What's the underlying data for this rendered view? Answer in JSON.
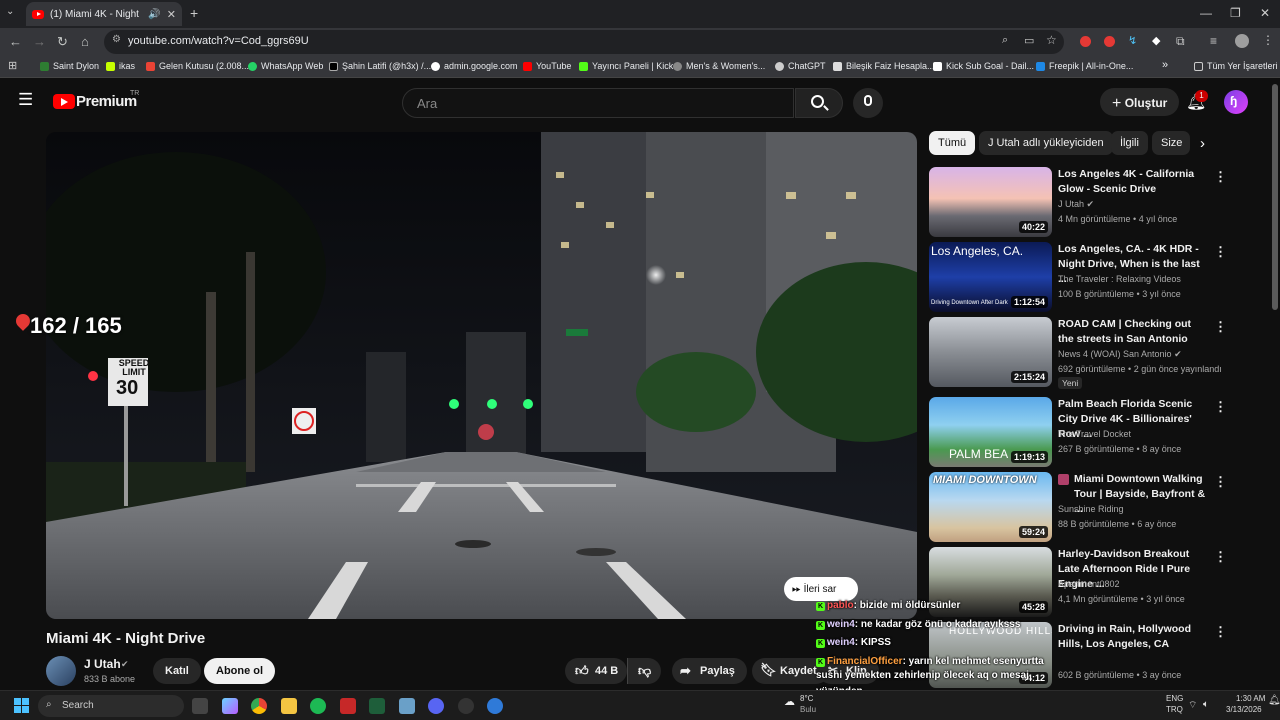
{
  "browser": {
    "tab_title": "(1) Miami 4K - Night Drive",
    "url": "youtube.com/watch?v=Cod_ggrs69U",
    "bookmarks": [
      "Saint Dylon",
      "ikas",
      "Gelen Kutusu (2.008...",
      "WhatsApp Web",
      "Şahin Latifi (@h3x) /...",
      "admin.google.com",
      "YouTube",
      "Yayıncı Paneli | Kick",
      "Men's & Women's...",
      "ChatGPT",
      "Bileşik Faiz Hesapla...",
      "Kick Sub Goal - Dail...",
      "Freepik | All-in-One..."
    ],
    "all_bookmarks": "Tüm Yer İşaretleri",
    "more": "»"
  },
  "youtube": {
    "logo": "Premium",
    "logo_sup": "TR",
    "search_placeholder": "Ara",
    "create_label": "Oluştur",
    "notif_count": "1"
  },
  "video": {
    "counter": "162 / 165",
    "title": "Miami 4K - Night Drive",
    "sign_speed_top": "SPEED LIMIT",
    "sign_speed_num": "30",
    "skip_label": "İleri sar",
    "skip_icon": "fast-forward-icon"
  },
  "channel": {
    "name": "J Utah",
    "subs": "833 B abone",
    "join": "Katıl",
    "subscribe": "Abone ol"
  },
  "actions": {
    "likes": "44 B",
    "share": "Paylaş",
    "save": "Kaydet",
    "clip": "Klip"
  },
  "chips": [
    "Tümü",
    "J Utah adlı yükleyiciden",
    "İlgili",
    "Size"
  ],
  "recommendations": [
    {
      "title": "Los Angeles 4K - California Glow - Scenic Drive",
      "channel": "J Utah",
      "meta": "4 Mn görüntüleme • 4 yıl önce",
      "duration": "40:22",
      "verified": true
    },
    {
      "title": "Los Angeles, CA. - 4K HDR - Night Drive, When is the last ...",
      "channel": "The Traveler : Relaxing Videos",
      "meta": "100 B görüntüleme • 3 yıl önce",
      "duration": "1:12:54",
      "thumb_text": "Los Angeles, CA.",
      "thumb_sub": "Driving Downtown After Dark"
    },
    {
      "title": "ROAD CAM | Checking out the streets in San Antonio",
      "channel": "News 4 (WOAI) San Antonio",
      "meta": "692 görüntüleme • 2 gün önce yayınlandı",
      "duration": "2:15:24",
      "badge": "Yeni",
      "verified": true
    },
    {
      "title": "Palm Beach Florida Scenic City Drive 4K - Billionaires' Row ...",
      "channel": "The Travel Docket",
      "meta": "267 B görüntüleme • 8 ay önce",
      "duration": "1:19:13",
      "thumb_text": "PALM BEA"
    },
    {
      "title": "Miami Downtown Walking Tour | Bayside, Bayfront & ...",
      "channel": "Sunshine Riding",
      "meta": "88 B görüntüleme • 6 ay önce",
      "duration": "59:24",
      "thumb_text": "MIAMI DOWNTOWN"
    },
    {
      "title": "Harley-Davidson Breakout Late Afternoon Ride I Pure Engine ...",
      "channel": "Apartment0802",
      "meta": "4,1 Mn görüntüleme • 3 yıl önce",
      "duration": "45:28"
    },
    {
      "title": "Driving in Rain, Hollywood Hills, Los Angeles, CA",
      "channel": "J Utah",
      "meta": "602 B görüntüleme • 3 ay önce",
      "duration": "44:12",
      "thumb_text": "HOLLYWOOD HILLS"
    }
  ],
  "chat": [
    {
      "user": "pablo",
      "text": ": bizide mi öldürsünler",
      "color": "red"
    },
    {
      "user": "wein4",
      "text": ": ne kadar göz önü o kadar ayıksss",
      "color": ""
    },
    {
      "user": "wein4",
      "text": ": KIPSS",
      "color": ""
    },
    {
      "user": "FinancialOfficer",
      "text": ": yarın kel mehmet esenyurtta",
      "color": "orange"
    },
    {
      "user": "",
      "text": "sushi yemekten zehirlenip ölecek aq o mesaj",
      "color": ""
    },
    {
      "user": "",
      "text": "yüzünden",
      "color": ""
    },
    {
      "user": "lolhemad",
      "text": ": nereyeeeeeeeeeeeeee",
      "color": ""
    }
  ],
  "taskbar": {
    "search": "Search",
    "weather": "8°C",
    "weather_sub": "Bulu",
    "lang1": "ENG",
    "lang2": "TRQ",
    "time": "1:30 AM",
    "date": "3/13/2026"
  }
}
